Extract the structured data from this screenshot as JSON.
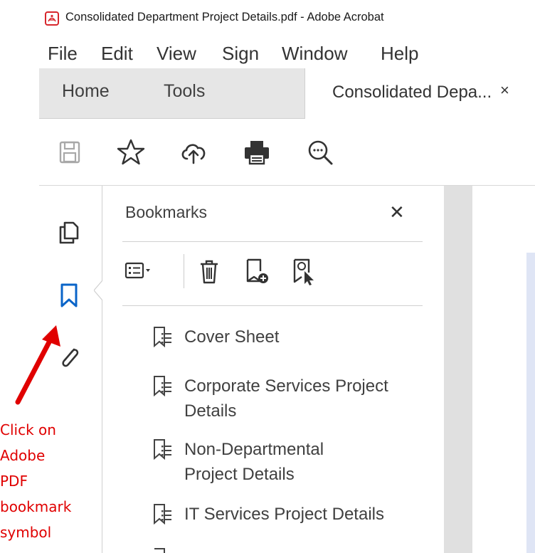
{
  "window": {
    "title": "Consolidated Department Project Details.pdf - Adobe Acrobat"
  },
  "menu": [
    "File",
    "Edit",
    "View",
    "Sign",
    "Window",
    "Help"
  ],
  "tabs": {
    "home": "Home",
    "tools": "Tools",
    "document": "Consolidated Depa...",
    "close_glyph": "×"
  },
  "toolbar": {
    "icons": [
      "save-icon",
      "bookmark-star-icon",
      "upload-cloud-icon",
      "print-icon",
      "search-zoom-icon"
    ]
  },
  "left_rail": {
    "icons": [
      "page-thumbnails-icon",
      "bookmark-icon",
      "attachment-icon"
    ],
    "active": "bookmark-icon"
  },
  "bookmarks_panel": {
    "title": "Bookmarks",
    "close_glyph": "✕",
    "tools": [
      "options-menu-icon",
      "delete-bookmark-icon",
      "new-bookmark-icon",
      "find-bookmark-icon"
    ],
    "items": [
      {
        "label": "Cover Sheet"
      },
      {
        "label": "Corporate Services Project Details"
      },
      {
        "label": "Non-Departmental Project Details"
      },
      {
        "label": "IT Services Project Details"
      }
    ]
  },
  "annotation": {
    "lines": [
      "Click on",
      "Adobe",
      "PDF",
      "bookmark",
      "symbol"
    ]
  },
  "colors": {
    "accent": "#0a64c8",
    "annotation": "#e00000",
    "app_icon": "#d7262c"
  }
}
